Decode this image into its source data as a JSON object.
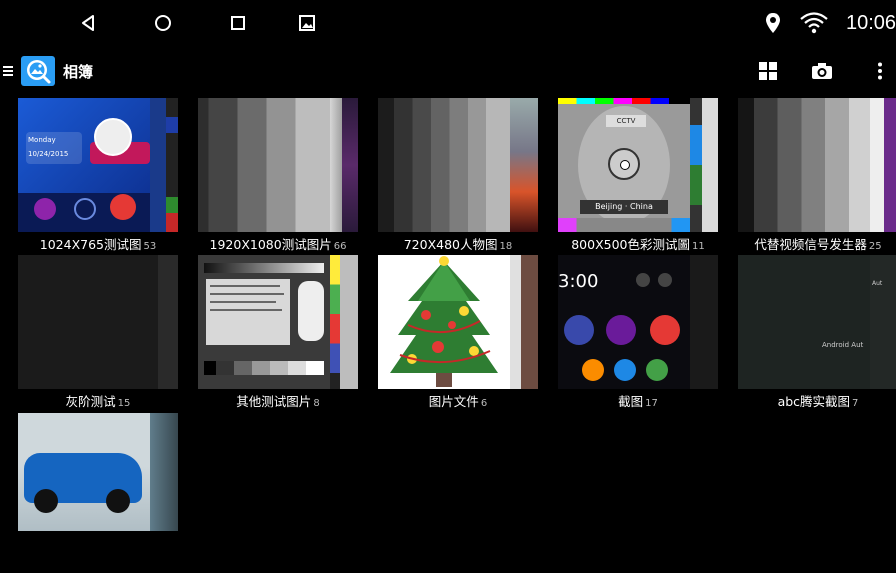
{
  "statusbar": {
    "time": "10:06"
  },
  "appbar": {
    "title": "相簿"
  },
  "albums": [
    {
      "name": "1024X765测试图",
      "count": "53"
    },
    {
      "name": "1920X1080测试图片",
      "count": "66"
    },
    {
      "name": "720X480人物图",
      "count": "18"
    },
    {
      "name": "800X500色彩测试圖",
      "count": "11"
    },
    {
      "name": "代替视频信号发生器",
      "count": "25"
    },
    {
      "name": "灰阶测试",
      "count": "15"
    },
    {
      "name": "其他测试图片",
      "count": "8"
    },
    {
      "name": "图片文件",
      "count": "6"
    },
    {
      "name": "截图",
      "count": "17"
    },
    {
      "name": "abc腾实截图",
      "count": "7"
    },
    {
      "name": "",
      "count": ""
    }
  ],
  "thumb_text": {
    "date_day": "Monday",
    "date": "10/24/2015",
    "cctv": "CCTV",
    "beijing": "Beijing · China",
    "clock": "3:00",
    "android_auto": "Android Aut",
    "auto_short": "Aut"
  },
  "colors": {
    "accent": "#2a9df4",
    "background": "#000000"
  }
}
